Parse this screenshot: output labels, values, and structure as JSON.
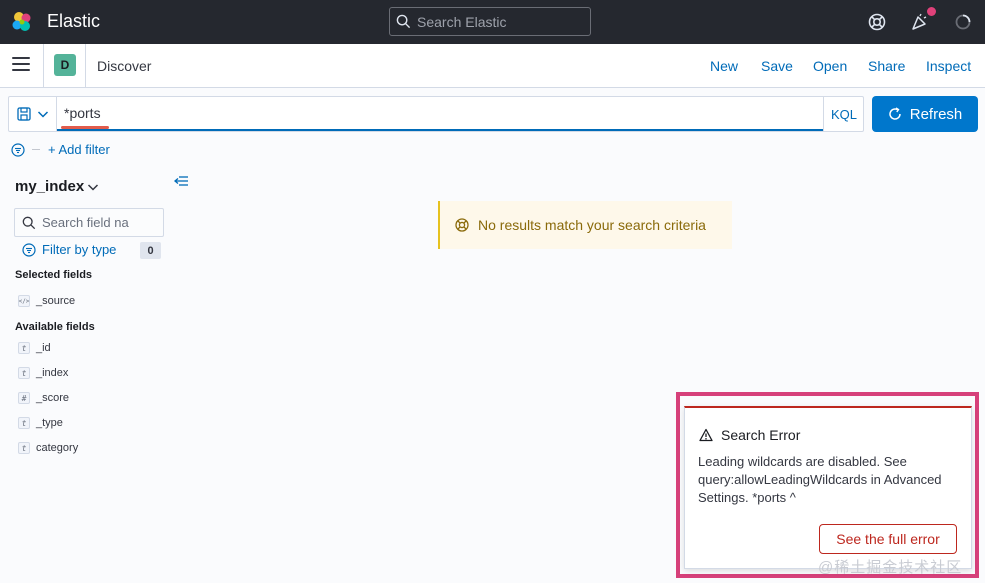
{
  "header": {
    "brand": "Elastic",
    "search_placeholder": "Search Elastic",
    "icons": [
      "elastic-logo",
      "help-icon",
      "newsfeed-icon",
      "loading-icon"
    ],
    "notification_dot_color": "#e0417a"
  },
  "appbar": {
    "space_initial": "D",
    "breadcrumb": "Discover",
    "nav": [
      "New",
      "Save",
      "Open",
      "Share",
      "Inspect"
    ]
  },
  "query": {
    "value": "*ports",
    "language": "KQL",
    "refresh_label": "Refresh",
    "add_filter_label": "+ Add filter"
  },
  "sidebar": {
    "index_pattern": "my_index",
    "field_search_placeholder": "Search field na",
    "filter_by_type_label": "Filter by type",
    "filter_count": "0",
    "selected_title": "Selected fields",
    "selected_fields": [
      {
        "type": "</>",
        "name": "_source"
      }
    ],
    "available_title": "Available fields",
    "available_fields": [
      {
        "type": "t",
        "name": "_id"
      },
      {
        "type": "t",
        "name": "_index"
      },
      {
        "type": "#",
        "name": "_score"
      },
      {
        "type": "t",
        "name": "_type"
      },
      {
        "type": "t",
        "name": "category"
      }
    ]
  },
  "main": {
    "no_results": "No results match your search criteria"
  },
  "toast": {
    "title": "Search Error",
    "body": "Leading wildcards are disabled. See query:allowLeadingWildcards in Advanced Settings. *ports ^",
    "button_label": "See the full error",
    "danger_color": "#bd271e",
    "highlight_color": "#d6407a"
  },
  "watermark": {
    "text": "@稀土掘金技术社区"
  },
  "colors": {
    "primary": "#0077cc",
    "link": "#006bb8",
    "header_bg": "#25282f",
    "warning_bg": "#fef8ea"
  }
}
